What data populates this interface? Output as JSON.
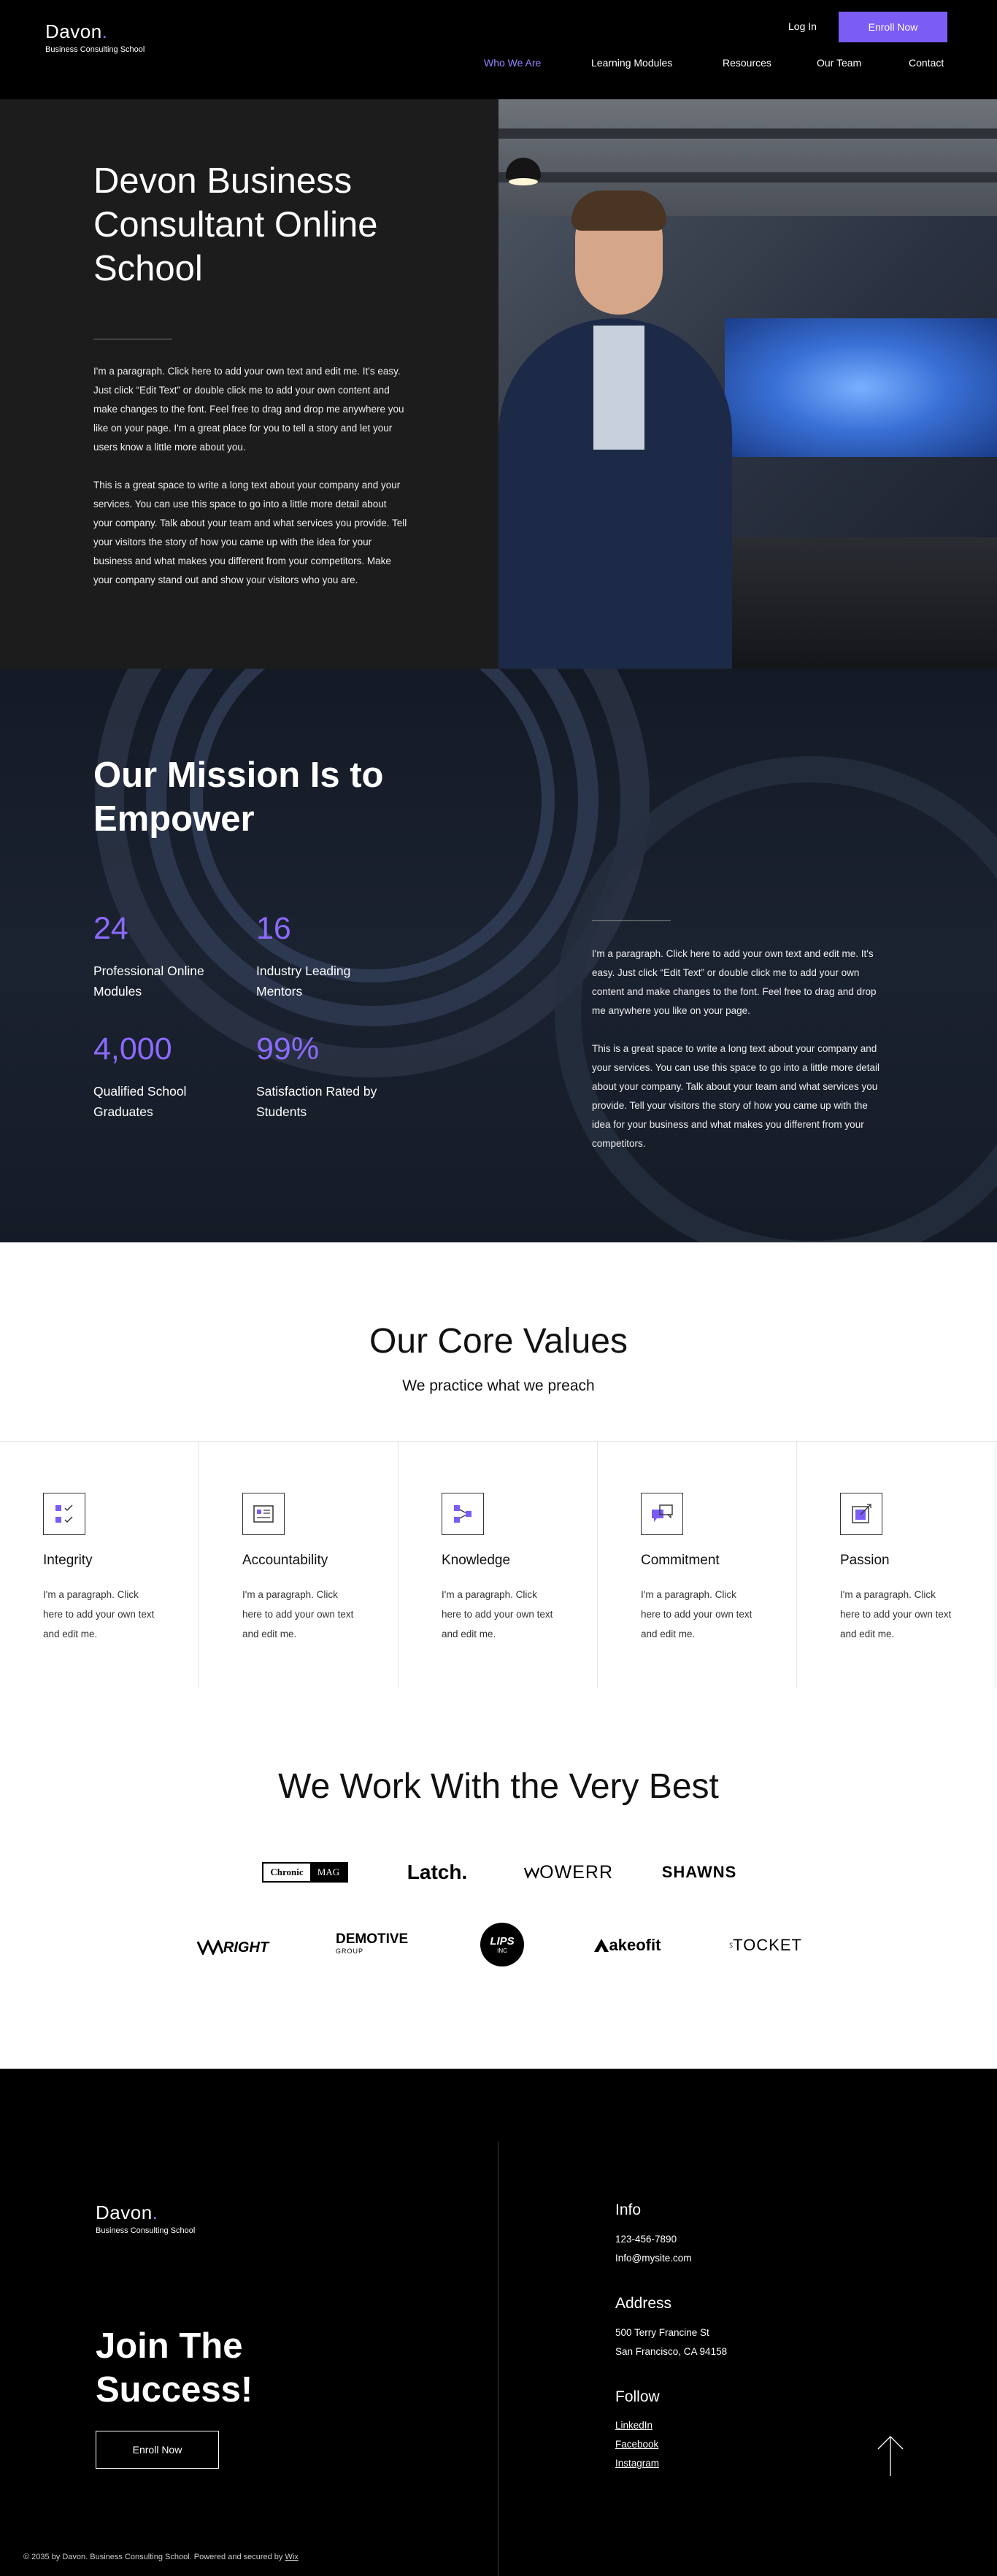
{
  "header": {
    "logo_name": "Davon",
    "logo_dot": ".",
    "logo_sub": "Business Consulting School",
    "login": "Log In",
    "enroll": "Enroll Now",
    "nav": [
      "Who We Are",
      "Learning Modules",
      "Resources",
      "Our Team",
      "Contact"
    ],
    "active_nav": "Who We Are"
  },
  "hero": {
    "title": "Devon Business Consultant Online School",
    "p1": "I'm a paragraph. Click here to add your own text and edit me. It's easy. Just click “Edit Text” or double click me to add your own content and make changes to the font. Feel free to drag and drop me anywhere you like on your page. I'm a great place for you to tell a story and let your users know a little more about you.",
    "p2": "This is a great space to write a long text about your company and your services. You can use this space to go into a little more detail about your company. Talk about your team and what services you provide. Tell your visitors the story of how you came up with the idea for your business and what makes you different from your competitors. Make your company stand out and show your visitors who you are."
  },
  "mission": {
    "title": "Our Mission Is to Empower",
    "stats": [
      {
        "number": "24",
        "label": "Professional Online Modules"
      },
      {
        "number": "16",
        "label": "Industry Leading Mentors"
      },
      {
        "number": "4,000",
        "label": "Qualified School Graduates"
      },
      {
        "number": "99%",
        "label": "Satisfaction Rated by Students"
      }
    ],
    "p1": "I'm a paragraph. Click here to add your own text and edit me. It's easy. Just click “Edit Text” or double click me to add your own content and make changes to the font. Feel free to drag and drop me anywhere you like on your page.",
    "p2": "This is a great space to write a long text about your company and your services. You can use this space to go into a little more detail about your company. Talk about your team and what services you provide. Tell your visitors the story of how you came up with the idea for your business and what makes you different from your competitors."
  },
  "values": {
    "title": "Our Core Values",
    "subtitle": "We practice what we preach",
    "items": [
      {
        "title": "Integrity",
        "text": "I'm a paragraph. Click here to add your own text and edit me.",
        "icon": "checklist-icon"
      },
      {
        "title": "Accountability",
        "text": "I'm a paragraph. Click here to add your own text and edit me.",
        "icon": "document-icon"
      },
      {
        "title": "Knowledge",
        "text": "I'm a paragraph. Click here to add your own text and edit me.",
        "icon": "network-icon"
      },
      {
        "title": "Commitment",
        "text": "I'm a paragraph. Click here to add your own text and edit me.",
        "icon": "chat-bubbles-icon"
      },
      {
        "title": "Passion",
        "text": "I'm a paragraph. Click here to add your own text and edit me.",
        "icon": "target-icon"
      }
    ],
    "accent": "#7b5cf5"
  },
  "partners": {
    "title": "We Work With the Very Best",
    "logos": [
      {
        "text": "Chronic",
        "text2": "MAG"
      },
      {
        "text": "Latch."
      },
      {
        "text": "OWERR"
      },
      {
        "text": "SHAWNS"
      },
      {
        "text": "RIGHT"
      },
      {
        "text": "DEMOTIVE",
        "text2": "GROUP"
      },
      {
        "text": "LIPS",
        "text2": "INC"
      },
      {
        "text": "akeofit"
      },
      {
        "text": "TOCKET"
      }
    ]
  },
  "footer": {
    "logo_name": "Davon",
    "logo_dot": ".",
    "logo_sub": "Business Consulting School",
    "title": "Join The Success!",
    "enroll": "Enroll Now",
    "info_head": "Info",
    "phone": "123-456-7890",
    "email": "Info@mysite.com",
    "address_head": "Address",
    "address1": "500 Terry Francine St",
    "address2": "San Francisco, CA 94158",
    "follow_head": "Follow",
    "links": [
      "LinkedIn",
      "Facebook",
      "Instagram"
    ],
    "copyright": "© 2035 by Davon. Business Consulting School. Powered and secured by",
    "wix": "Wix"
  },
  "colors": {
    "accent": "#7b5cf5",
    "stat": "#8b6bff",
    "dark": "#1c1c1d"
  }
}
